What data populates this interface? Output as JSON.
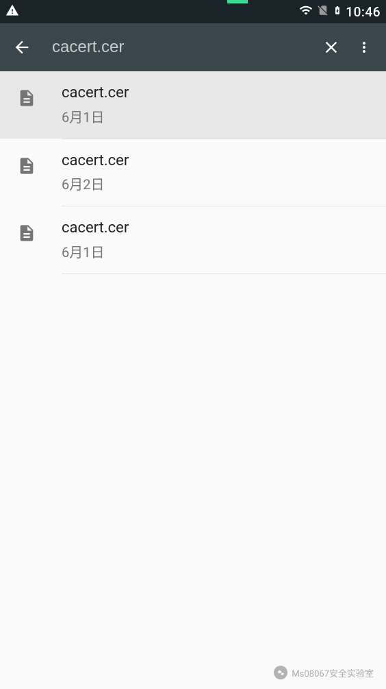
{
  "status_bar": {
    "time": "10:46"
  },
  "app_bar": {
    "search_value": "cacert.cer"
  },
  "results": [
    {
      "name": "cacert.cer",
      "date": "6月1日",
      "highlighted": true
    },
    {
      "name": "cacert.cer",
      "date": "6月2日",
      "highlighted": false
    },
    {
      "name": "cacert.cer",
      "date": "6月1日",
      "highlighted": false
    }
  ],
  "watermark": {
    "text": "Ms08067安全实验室"
  }
}
